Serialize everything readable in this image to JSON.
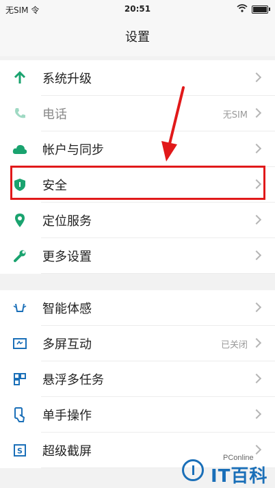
{
  "status_bar": {
    "carrier": "无SIM 令",
    "time": "20:51"
  },
  "header": {
    "title": "设置"
  },
  "group1": [
    {
      "label": "系统升级",
      "icon": "arrow-up-icon"
    },
    {
      "label": "电话",
      "value": "无SIM",
      "icon": "phone-icon"
    },
    {
      "label": "帐户与同步",
      "icon": "cloud-icon"
    },
    {
      "label": "安全",
      "icon": "shield-icon"
    },
    {
      "label": "定位服务",
      "icon": "location-pin-icon"
    },
    {
      "label": "更多设置",
      "icon": "wrench-icon"
    }
  ],
  "group2": [
    {
      "label": "智能体感",
      "icon": "gesture-icon"
    },
    {
      "label": "多屏互动",
      "value": "已关闭",
      "icon": "screen-cast-icon"
    },
    {
      "label": "悬浮多任务",
      "icon": "multitask-icon"
    },
    {
      "label": "单手操作",
      "icon": "hand-icon"
    },
    {
      "label": "超级截屏",
      "icon": "screenshot-icon"
    }
  ],
  "watermark": {
    "small": "PConline",
    "brand": "IT百科"
  },
  "colors": {
    "accent": "#1aa36f",
    "highlight": "#e1191a",
    "watermark": "#1a6fb8"
  }
}
